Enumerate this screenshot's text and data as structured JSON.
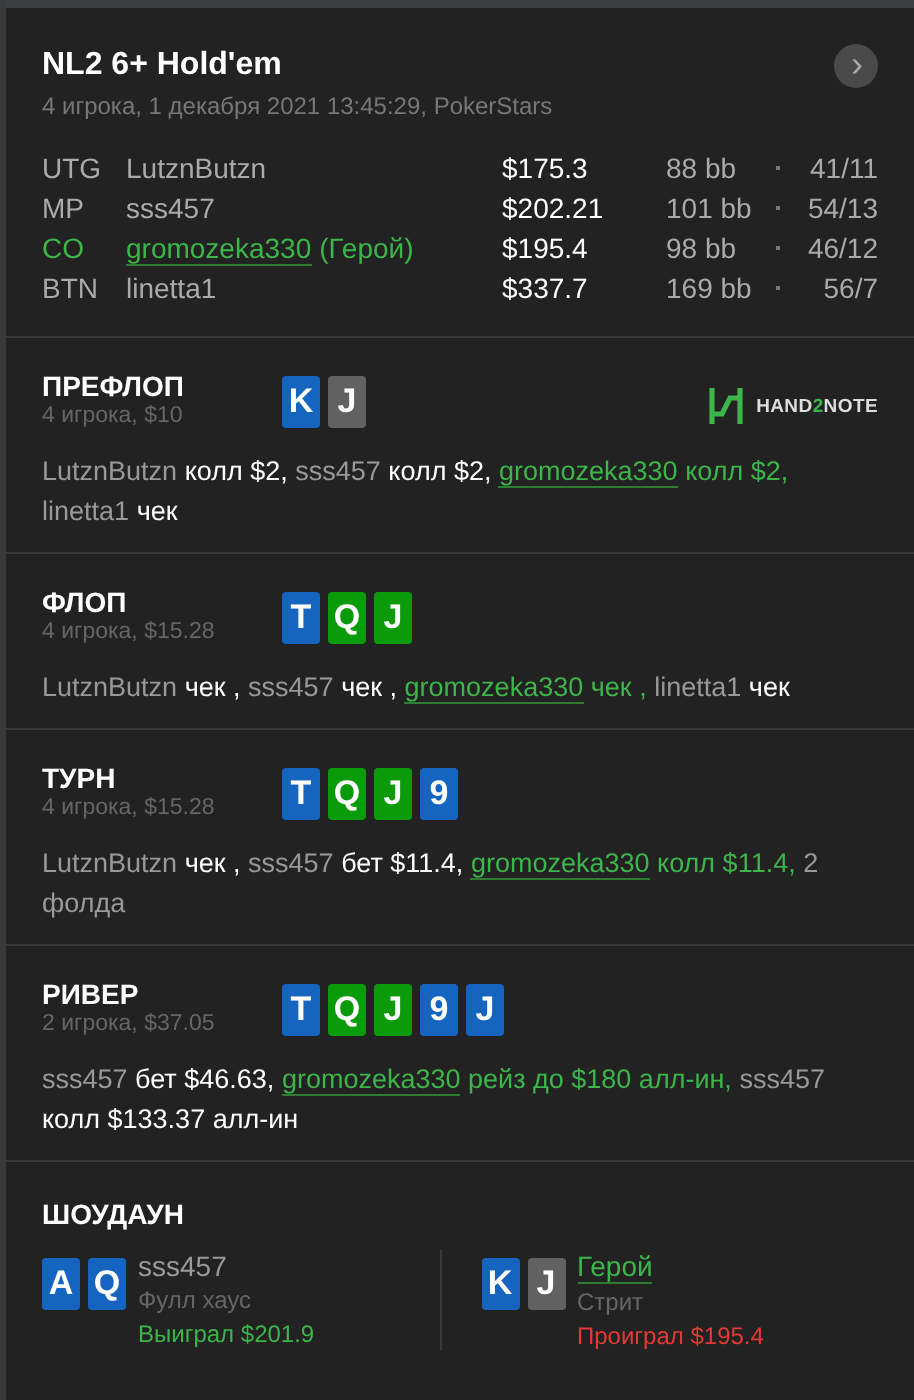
{
  "header": {
    "title": "NL2 6+ Hold'em",
    "subtitle": "4 игрока, 1 декабря 2021 13:45:29, PokerStars",
    "next_button": "›"
  },
  "players": [
    {
      "position": "UTG",
      "name": "LutznButzn",
      "hero": false,
      "stack": "$175.3",
      "bb": "88 bb",
      "stats": "41/11"
    },
    {
      "position": "MP",
      "name": "sss457",
      "hero": false,
      "stack": "$202.21",
      "bb": "101 bb",
      "stats": "54/13"
    },
    {
      "position": "CO",
      "name": "gromozeka330",
      "hero": true,
      "hero_tag": "(Герой)",
      "stack": "$195.4",
      "bb": "98 bb",
      "stats": "46/12"
    },
    {
      "position": "BTN",
      "name": "linetta1",
      "hero": false,
      "stack": "$337.7",
      "bb": "169 bb",
      "stats": "56/7"
    }
  ],
  "streets": [
    {
      "title": "ПРЕФЛОП",
      "info": "4 игрока, $10",
      "logo": {
        "text_a": "HAND",
        "text_b": "2",
        "text_c": "NOTE"
      },
      "cards": [
        {
          "rank": "K",
          "color": "#1565c0"
        },
        {
          "rank": "J",
          "color": "#616161"
        }
      ],
      "actions": [
        {
          "player": "LutznButzn",
          "action": "колл $2,",
          "hero": false
        },
        {
          "player": "sss457",
          "action": "колл $2,",
          "hero": false
        },
        {
          "player": "gromozeka330",
          "action": "колл $2,",
          "hero": true
        },
        {
          "player": "linetta1",
          "action": "чек",
          "hero": false
        }
      ]
    },
    {
      "title": "ФЛОП",
      "info": "4 игрока, $15.28",
      "cards": [
        {
          "rank": "T",
          "color": "#1565c0"
        },
        {
          "rank": "Q",
          "color": "#0a9a0a"
        },
        {
          "rank": "J",
          "color": "#0a9a0a"
        }
      ],
      "actions": [
        {
          "player": "LutznButzn",
          "action": "чек ,",
          "hero": false
        },
        {
          "player": "sss457",
          "action": "чек ,",
          "hero": false
        },
        {
          "player": "gromozeka330",
          "action": "чек ,",
          "hero": true
        },
        {
          "player": "linetta1",
          "action": "чек",
          "hero": false
        }
      ]
    },
    {
      "title": "ТУРН",
      "info": "4 игрока, $15.28",
      "cards": [
        {
          "rank": "T",
          "color": "#1565c0"
        },
        {
          "rank": "Q",
          "color": "#0a9a0a"
        },
        {
          "rank": "J",
          "color": "#0a9a0a"
        },
        {
          "rank": "9",
          "color": "#1565c0"
        }
      ],
      "actions": [
        {
          "player": "LutznButzn",
          "action": "чек ,",
          "hero": false
        },
        {
          "player": "sss457",
          "action": "бет $11.4,",
          "hero": false
        },
        {
          "player": "gromozeka330",
          "action": "колл $11.4,",
          "hero": true
        }
      ],
      "note": "2 фолда"
    },
    {
      "title": "РИВЕР",
      "info": "2 игрока, $37.05",
      "cards": [
        {
          "rank": "T",
          "color": "#1565c0"
        },
        {
          "rank": "Q",
          "color": "#0a9a0a"
        },
        {
          "rank": "J",
          "color": "#0a9a0a"
        },
        {
          "rank": "9",
          "color": "#1565c0"
        },
        {
          "rank": "J",
          "color": "#1565c0"
        }
      ],
      "actions": [
        {
          "player": "sss457",
          "action": "бет $46.63,",
          "hero": false
        },
        {
          "player": "gromozeka330",
          "action": "рейз до $180 алл-ин,",
          "hero": true
        },
        {
          "player": "sss457",
          "action": "колл $133.37 алл-ин",
          "hero": false
        }
      ]
    }
  ],
  "showdown": {
    "title": "ШОУДАУН",
    "hands": [
      {
        "player": "sss457",
        "hero": false,
        "combo": "Фулл хаус",
        "result": "Выиграл $201.9",
        "won": true,
        "cards": [
          {
            "rank": "A",
            "color": "#1565c0"
          },
          {
            "rank": "Q",
            "color": "#1565c0"
          }
        ]
      },
      {
        "player": "Герой",
        "hero": true,
        "combo": "Стрит",
        "result": "Проиграл $195.4",
        "won": false,
        "cards": [
          {
            "rank": "K",
            "color": "#1565c0"
          },
          {
            "rank": "J",
            "color": "#616161"
          }
        ]
      }
    ]
  }
}
